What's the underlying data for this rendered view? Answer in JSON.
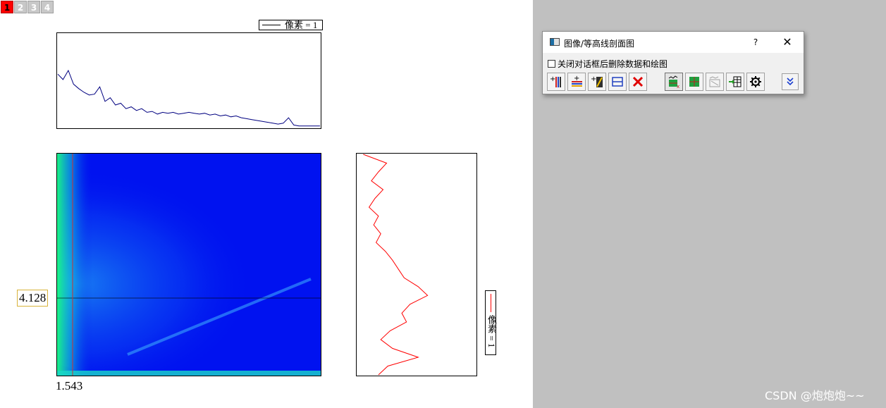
{
  "layer_tabs": [
    {
      "label": "1",
      "active": true
    },
    {
      "label": "2",
      "active": false
    },
    {
      "label": "3",
      "active": false
    },
    {
      "label": "4",
      "active": false
    }
  ],
  "top_legend": "像素 = 1",
  "right_legend": "像素 = 1",
  "cursor_readout": {
    "y": "4.128",
    "x": "1.543"
  },
  "colors": {
    "top_profile_line": "#000080",
    "side_profile_line": "#ff0000",
    "cursor_line": "#cc3333",
    "heatmap_background": "#0012f0"
  },
  "dialog": {
    "title": "图像/等高线剖面图",
    "help_label": "?",
    "close_label": "✕",
    "checkbox_label": "关闭对话框后删除数据和绘图",
    "checkbox_checked": false,
    "toolbar_buttons": [
      {
        "name": "add-vertical-line",
        "icon": "add-vertical-line-icon",
        "pressed": false
      },
      {
        "name": "add-horizontal-line",
        "icon": "add-horizontal-line-icon",
        "pressed": false
      },
      {
        "name": "add-arbitrary-line",
        "icon": "add-arbitrary-line-icon",
        "pressed": false
      },
      {
        "name": "line-settings",
        "icon": "horizontal-lines-icon",
        "pressed": false
      },
      {
        "name": "delete-line",
        "icon": "red-x-delete-icon",
        "pressed": false
      },
      {
        "name": "show-horizontal-profile",
        "icon": "horizontal-profile-icon",
        "pressed": true
      },
      {
        "name": "show-vertical-profile",
        "icon": "vertical-profile-icon",
        "pressed": false
      },
      {
        "name": "show-arbitrary-profile",
        "icon": "arbitrary-profile-icon",
        "pressed": false
      },
      {
        "name": "export-worksheet",
        "icon": "export-worksheet-icon",
        "pressed": false
      },
      {
        "name": "settings",
        "icon": "gear-icon",
        "pressed": false
      },
      {
        "name": "expand-dialog",
        "icon": "double-chevron-down-icon",
        "pressed": false
      }
    ]
  },
  "watermark": "CSDN @炮炮炮~~",
  "chart_data": [
    {
      "type": "line",
      "title": "",
      "series": [
        {
          "name": "像素 = 1",
          "x": [
            0,
            2,
            4,
            6,
            8,
            10,
            12,
            14,
            16,
            18,
            20,
            22,
            24,
            26,
            28,
            30,
            32,
            34,
            36,
            38,
            40,
            42,
            44,
            46,
            48,
            50,
            52,
            54,
            56,
            58,
            60,
            62,
            64,
            66,
            68,
            70,
            72,
            74,
            76,
            78,
            80,
            82,
            84,
            86,
            88,
            90,
            92,
            94,
            96,
            98,
            100
          ],
          "y": [
            0.58,
            0.52,
            0.62,
            0.47,
            0.42,
            0.38,
            0.35,
            0.36,
            0.44,
            0.28,
            0.32,
            0.24,
            0.26,
            0.2,
            0.22,
            0.18,
            0.2,
            0.16,
            0.17,
            0.14,
            0.16,
            0.15,
            0.16,
            0.14,
            0.15,
            0.16,
            0.15,
            0.14,
            0.15,
            0.13,
            0.14,
            0.12,
            0.13,
            0.11,
            0.12,
            0.1,
            0.09,
            0.08,
            0.07,
            0.06,
            0.05,
            0.04,
            0.03,
            0.04,
            0.1,
            0.02,
            0.01,
            0.01,
            0.01,
            0.01,
            0.01
          ]
        }
      ]
    },
    {
      "type": "line",
      "title": "",
      "series": [
        {
          "name": "像素 = 1",
          "y": [
            0,
            4,
            8,
            12,
            16,
            20,
            24,
            28,
            32,
            36,
            40,
            44,
            48,
            52,
            56,
            60,
            64,
            68,
            72,
            76,
            80,
            84,
            88,
            92,
            96,
            100
          ],
          "x": [
            0.05,
            0.25,
            0.18,
            0.12,
            0.22,
            0.15,
            0.1,
            0.18,
            0.14,
            0.2,
            0.16,
            0.24,
            0.3,
            0.35,
            0.4,
            0.52,
            0.6,
            0.45,
            0.38,
            0.42,
            0.28,
            0.2,
            0.3,
            0.52,
            0.26,
            0.18
          ]
        }
      ]
    }
  ]
}
